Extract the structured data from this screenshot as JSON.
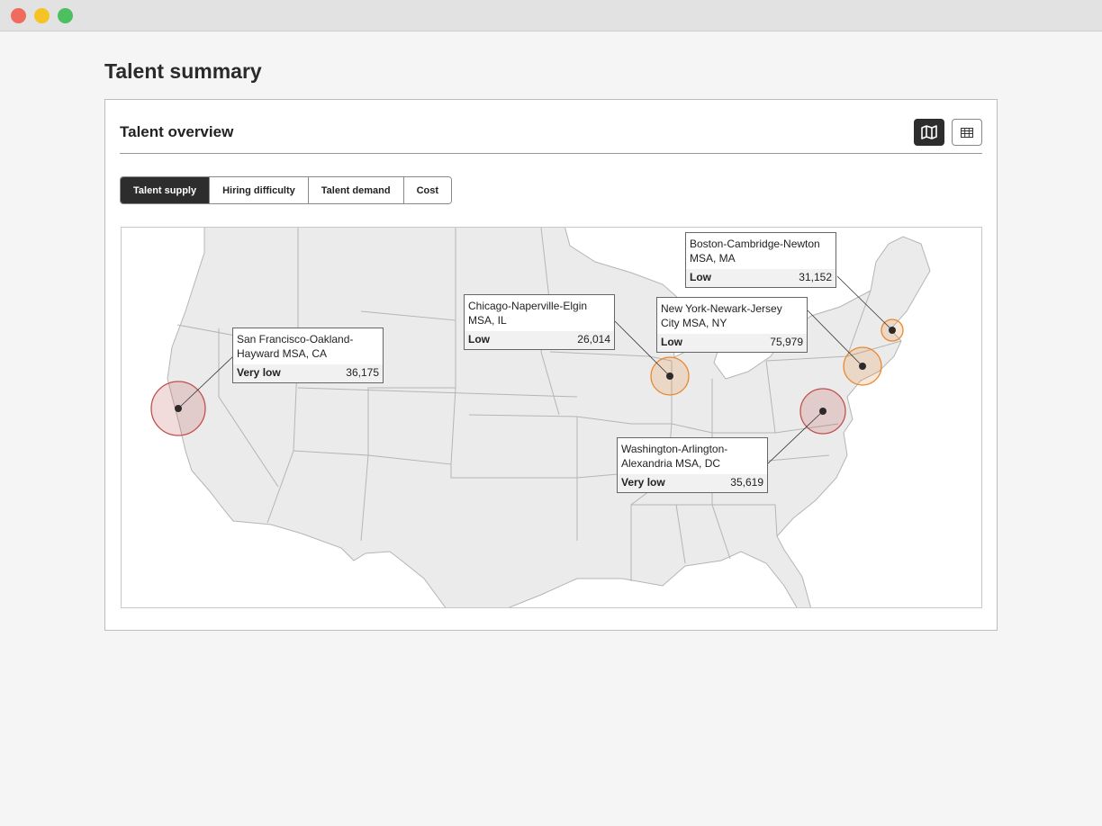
{
  "window": {
    "controls": [
      {
        "name": "close",
        "color": "#ef6b5e"
      },
      {
        "name": "minimize",
        "color": "#f5c324"
      },
      {
        "name": "maximize",
        "color": "#4cbf60"
      }
    ]
  },
  "page": {
    "title": "Talent summary"
  },
  "card": {
    "title": "Talent overview",
    "view_toggle": [
      {
        "icon": "map-icon",
        "active": true
      },
      {
        "icon": "table-icon",
        "active": false
      }
    ],
    "tabs": [
      {
        "label": "Talent supply",
        "active": true
      },
      {
        "label": "Hiring difficulty",
        "active": false
      },
      {
        "label": "Talent demand",
        "active": false
      },
      {
        "label": "Cost",
        "active": false
      }
    ]
  },
  "map": {
    "colors": {
      "land": "#ebebeb",
      "border": "#b5b5b5",
      "very_low": "#c0504d",
      "low": "#e8882e"
    },
    "markers": [
      {
        "name": "San Francisco-Oakland-Hayward MSA, CA",
        "level": "Very low",
        "value": "36,175"
      },
      {
        "name": "Chicago-Naperville-Elgin MSA, IL",
        "level": "Low",
        "value": "26,014"
      },
      {
        "name": "Boston-Cambridge-Newton MSA, MA",
        "level": "Low",
        "value": "31,152"
      },
      {
        "name": "New York-Newark-Jersey City MSA, NY",
        "level": "Low",
        "value": "75,979"
      },
      {
        "name": "Washington-Arlington-Alexandria MSA, DC",
        "level": "Very low",
        "value": "35,619"
      }
    ]
  }
}
